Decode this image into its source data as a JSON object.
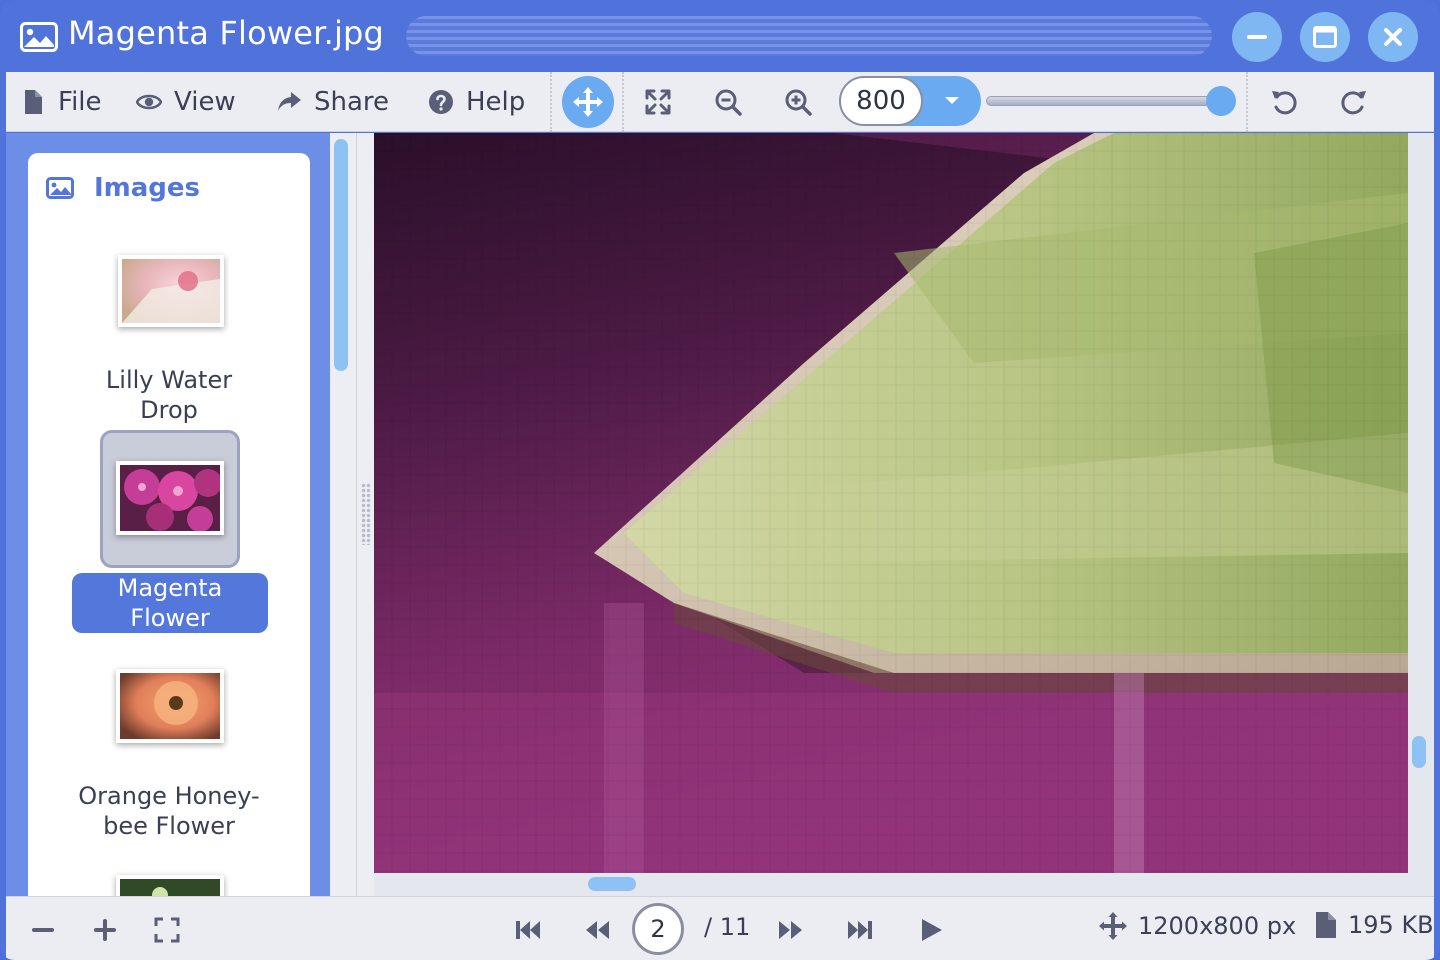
{
  "window": {
    "title": "Magenta Flower.jpg"
  },
  "menu": {
    "file": "File",
    "view": "View",
    "share": "Share",
    "help": "Help"
  },
  "toolbar": {
    "zoom_value": "800",
    "zoom_slider_level": 1.0
  },
  "sidebar": {
    "header": "Images",
    "items": [
      {
        "caption_line1": "Lilly Water",
        "caption_line2": "Drop",
        "selected": false
      },
      {
        "caption_line1": "Magenta",
        "caption_line2": "Flower",
        "selected": true
      },
      {
        "caption_line1": "Orange Honey-",
        "caption_line2": "bee Flower",
        "selected": false
      }
    ]
  },
  "status": {
    "current_page": "2",
    "total_pages": "/ 11",
    "dimensions": "1200x800 px",
    "file_size": "195 KB"
  },
  "colors": {
    "accent": "#4f72db",
    "highlight": "#6aaaf0",
    "selected": "#5477dc"
  }
}
